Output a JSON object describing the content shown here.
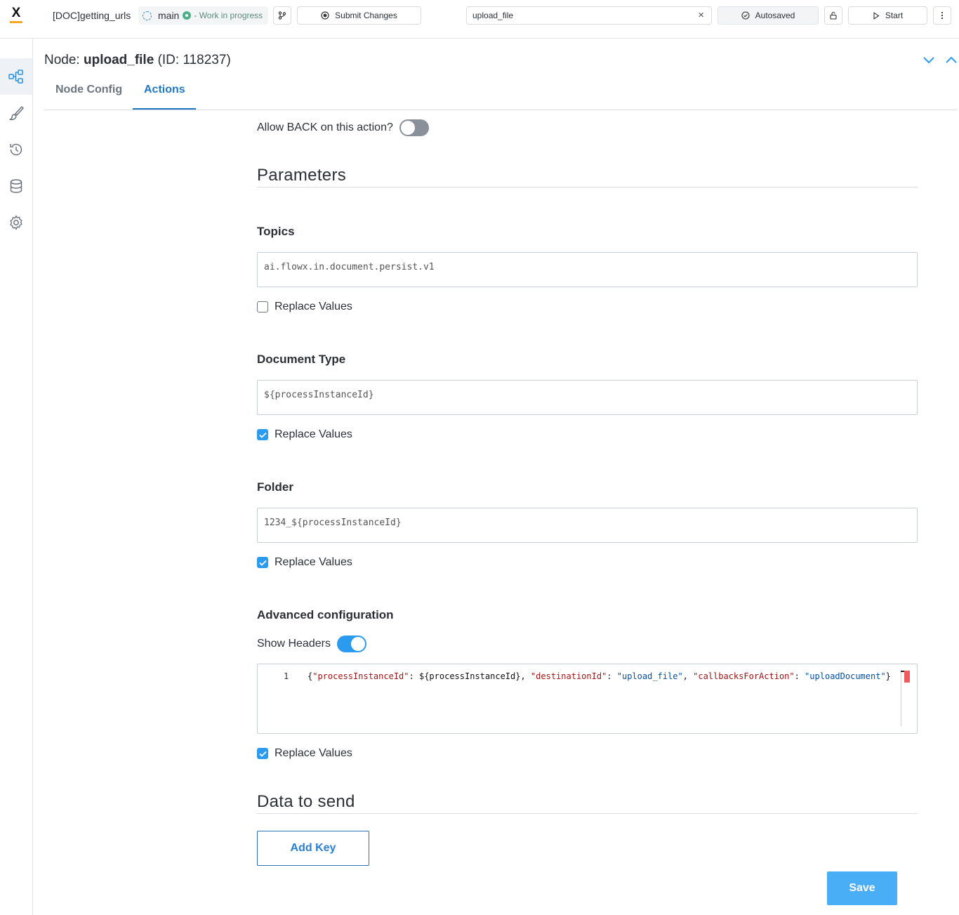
{
  "topbar": {
    "logo_letter": "X",
    "process_name": "[DOC]getting_urls",
    "branch": "main",
    "branch_status": "- Work in progress",
    "submit_label": "Submit Changes",
    "search_value": "upload_file",
    "clear_icon": "×",
    "autosaved_label": "Autosaved",
    "start_label": "Start"
  },
  "node": {
    "prefix": "Node:",
    "name": "upload_file",
    "id_text": "(ID: 118237)"
  },
  "tabs": [
    {
      "label": "Node Config",
      "active": false
    },
    {
      "label": "Actions",
      "active": true
    }
  ],
  "form": {
    "allow_back_label": "Allow BACK on this action?",
    "allow_back_on": false,
    "parameters_heading": "Parameters",
    "topics_label": "Topics",
    "topics_value": "ai.flowx.in.document.persist.v1",
    "topics_replace_label": "Replace Values",
    "topics_replace": false,
    "doc_type_label": "Document Type",
    "doc_type_value": "${processInstanceId}",
    "doc_type_replace_label": "Replace Values",
    "doc_type_replace": true,
    "folder_label": "Folder",
    "folder_value": "1234_${processInstanceId}",
    "folder_replace_label": "Replace Values",
    "folder_replace": true,
    "advanced_label": "Advanced configuration",
    "show_headers_label": "Show Headers",
    "show_headers_on": true,
    "code_line_number": "1",
    "code_tokens": {
      "brace_open": "{",
      "k1": "\"processInstanceId\"",
      "c1": ": ",
      "v1": "${processInstanceId}",
      "c2": ", ",
      "k2": "\"destinationId\"",
      "c3": ": ",
      "v2": "\"upload_file\"",
      "c4": ", ",
      "k3": "\"callbacksForAction\"",
      "c5": ": ",
      "v3": "\"uploadDocument\"",
      "brace_close": "}"
    },
    "headers_replace_label": "Replace Values",
    "headers_replace": true,
    "data_heading": "Data to send",
    "add_key_label": "Add Key",
    "save_label": "Save"
  },
  "colors": {
    "accent": "#2a9bef",
    "tab_active": "#1f78c1",
    "save_bg": "#49aef5",
    "status_green": "#4caf8a"
  }
}
